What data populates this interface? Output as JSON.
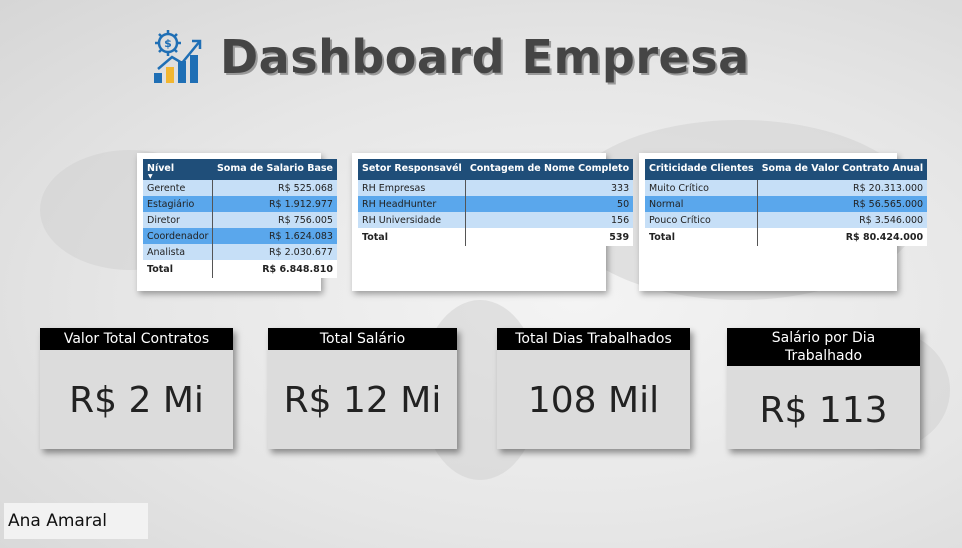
{
  "header": {
    "title": "Dashboard Empresa",
    "logo_icon": "dollar-gear-growth-chart-icon",
    "accent_color": "#1f6fb5"
  },
  "tables": [
    {
      "columns": [
        "Nível",
        "Soma de Salario Base"
      ],
      "rows": [
        [
          "Gerente",
          "R$ 525.068"
        ],
        [
          "Estagiário",
          "R$ 1.912.977"
        ],
        [
          "Diretor",
          "R$ 756.005"
        ],
        [
          "Coordenador",
          "R$ 1.624.083"
        ],
        [
          "Analista",
          "R$ 2.030.677"
        ]
      ],
      "total": [
        "Total",
        "R$ 6.848.810"
      ]
    },
    {
      "columns": [
        "Setor Responsavél",
        "Contagem de Nome Completo"
      ],
      "rows": [
        [
          "RH Empresas",
          "333"
        ],
        [
          "RH HeadHunter",
          "50"
        ],
        [
          "RH Universidade",
          "156"
        ]
      ],
      "total": [
        "Total",
        "539"
      ]
    },
    {
      "columns": [
        "Criticidade Clientes",
        "Soma de Valor Contrato Anual"
      ],
      "rows": [
        [
          "Muito Crítico",
          "R$ 20.313.000"
        ],
        [
          "Normal",
          "R$ 56.565.000"
        ],
        [
          "Pouco Crítico",
          "R$ 3.546.000"
        ]
      ],
      "total": [
        "Total",
        "R$ 80.424.000"
      ]
    }
  ],
  "kpis": [
    {
      "label": "Valor Total Contratos",
      "value": "R$ 2 Mi"
    },
    {
      "label": "Total Salário",
      "value": "R$ 12 Mi"
    },
    {
      "label": "Total Dias Trabalhados",
      "value": "108 Mil"
    },
    {
      "label": "Salário por Dia Trabalhado",
      "value": "R$ 113"
    }
  ],
  "footer": {
    "author": "Ana Amaral"
  },
  "colors": {
    "table_header": "#1f4e79",
    "row_light": "#c6dff7",
    "row_dark": "#5aa7ec",
    "kpi_header": "#000000",
    "kpi_body": "#dcdcdc"
  }
}
